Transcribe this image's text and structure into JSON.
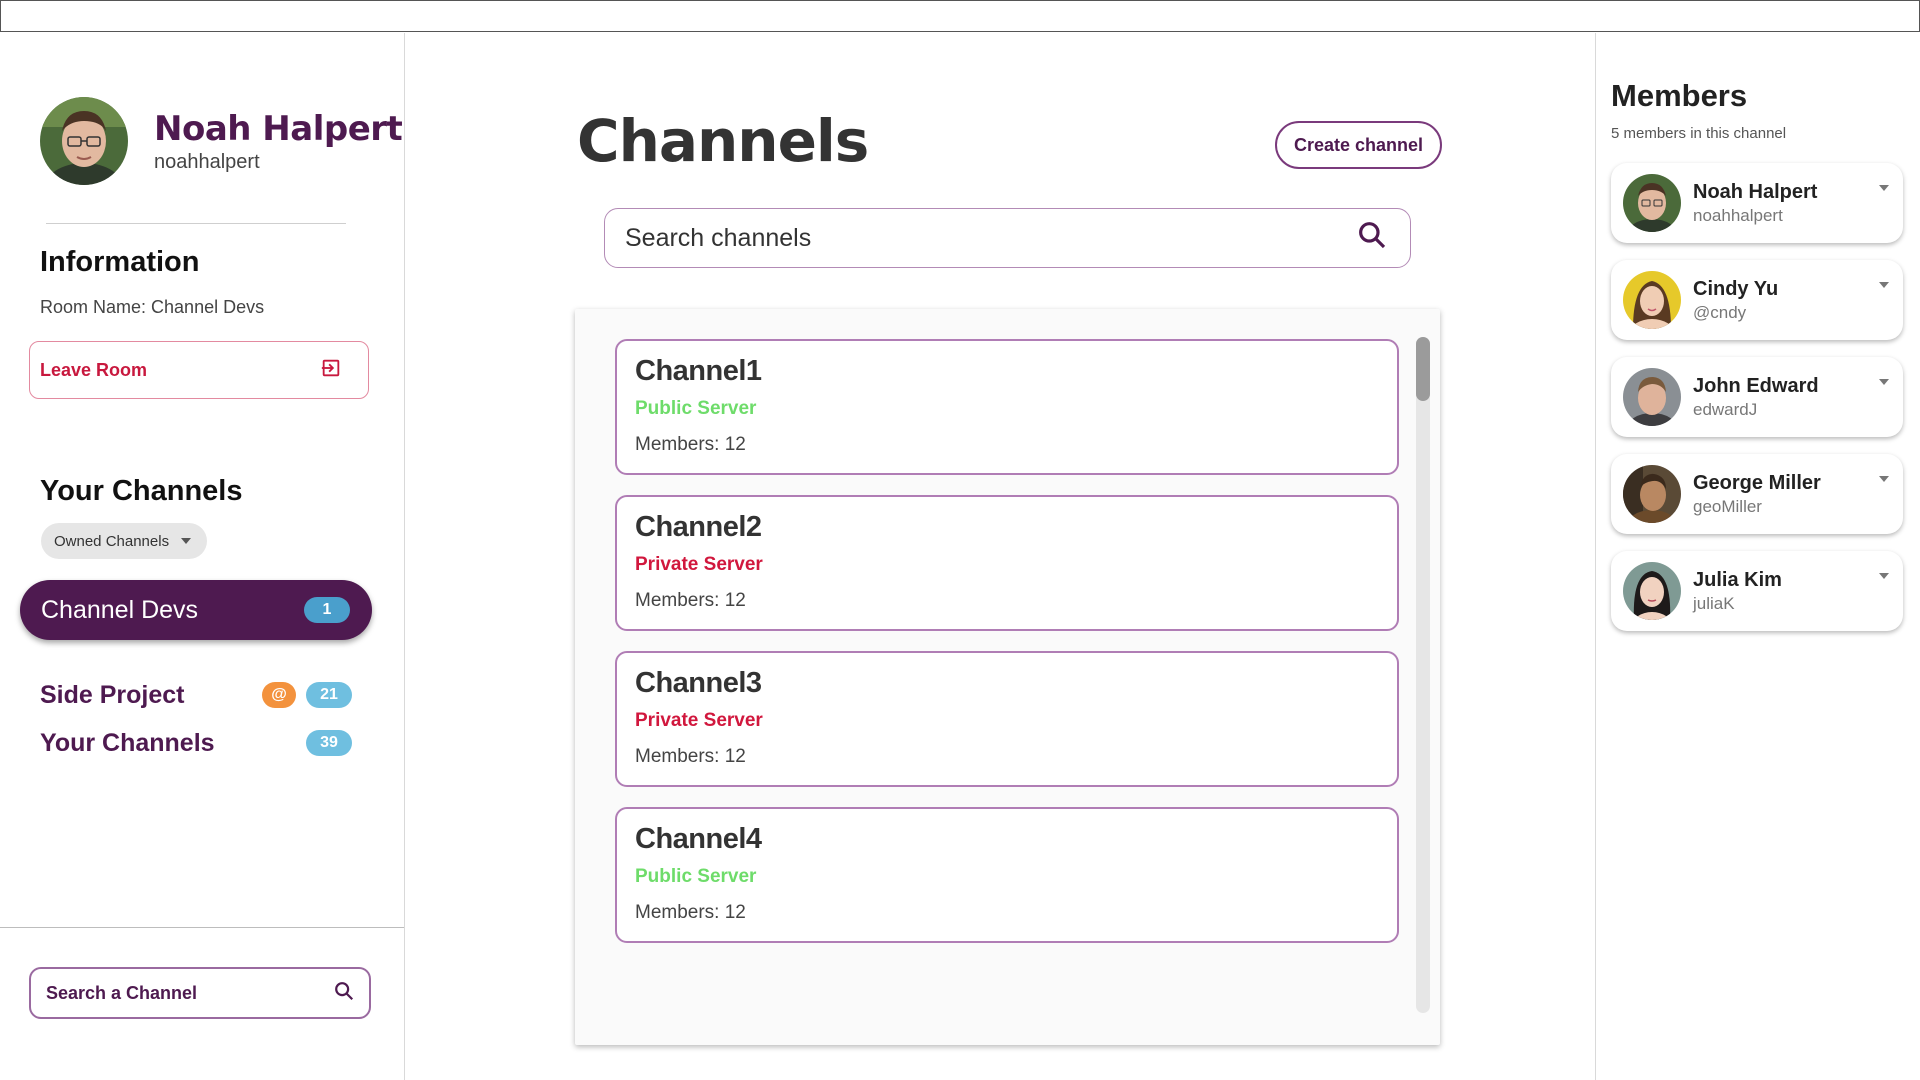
{
  "profile": {
    "name": "Noah Halpert",
    "username": "noahhalpert",
    "avatar_icon": "user-avatar"
  },
  "information": {
    "title": "Information",
    "room_name": "Room Name: Channel Devs",
    "leave_label": "Leave Room",
    "leave_icon": "logout-icon"
  },
  "your_channels": {
    "title": "Your Channels",
    "filter": "Owned Channels",
    "active": {
      "label": "Channel Devs",
      "count": "1"
    },
    "items": [
      {
        "label": "Side Project",
        "mention": "@",
        "count": "21"
      },
      {
        "label": "Your Channels",
        "count": "39"
      }
    ]
  },
  "sidebar_search": {
    "placeholder": "Search a Channel"
  },
  "main": {
    "title": "Channels",
    "create_label": "Create channel",
    "search_placeholder": "Search channels",
    "channels": [
      {
        "name": "Channel1",
        "type": "Public Server",
        "members": "Members: 12"
      },
      {
        "name": "Channel2",
        "type": "Private Server",
        "members": "Members: 12"
      },
      {
        "name": "Channel3",
        "type": "Private Server",
        "members": "Members: 12"
      },
      {
        "name": "Channel4",
        "type": "Public Server",
        "members": "Members: 12"
      }
    ]
  },
  "members": {
    "title": "Members",
    "subtitle": "5 members in this channel",
    "list": [
      {
        "name": "Noah Halpert",
        "username": "noahhalpert"
      },
      {
        "name": "Cindy Yu",
        "username": "@cndy"
      },
      {
        "name": "John Edward",
        "username": "edwardJ"
      },
      {
        "name": "George Miller",
        "username": "geoMiller"
      },
      {
        "name": "Julia Kim",
        "username": "juliaK"
      }
    ]
  },
  "colors": {
    "brand": "#4e1a50",
    "public": "#6edc6a",
    "private": "#d1173d",
    "badge": "#4a9fcc",
    "mention": "#f3923d"
  }
}
